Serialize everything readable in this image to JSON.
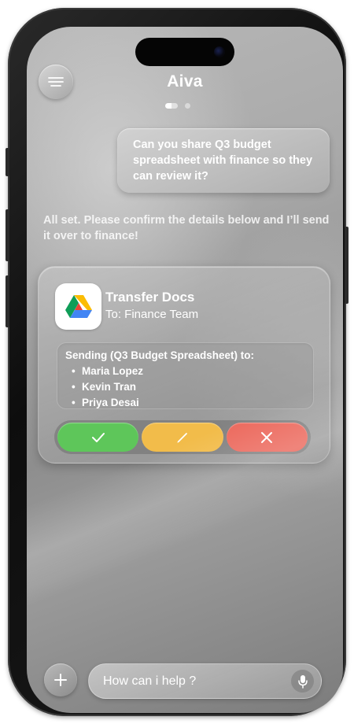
{
  "header": {
    "menu_icon": "menu-lines-icon",
    "title": "Aiva",
    "pages": 2,
    "active_page": 1
  },
  "conversation": {
    "user_message": "Can you share Q3 budget spreadsheet with finance so they can review it?",
    "assistant_message": "All set. Please confirm the details below and I’ll send it over to finance!"
  },
  "action_card": {
    "app_icon": "google-drive-icon",
    "title": "Transfer Docs",
    "recipient": "To: Finance Team",
    "details_heading": "Sending (Q3 Budget Spreadsheet) to:",
    "recipients": [
      "Maria Lopez",
      "Kevin Tran",
      "Priya Desai"
    ],
    "buttons": {
      "confirm_icon": "checkmark-icon",
      "edit_icon": "pencil-icon",
      "cancel_icon": "close-icon"
    },
    "colors": {
      "confirm": "#5ec65a",
      "edit": "#f2bc4a",
      "cancel": "#ec6a5e"
    }
  },
  "composer": {
    "add_icon": "plus-icon",
    "placeholder": "How can i help ?",
    "mic_icon": "microphone-icon"
  }
}
